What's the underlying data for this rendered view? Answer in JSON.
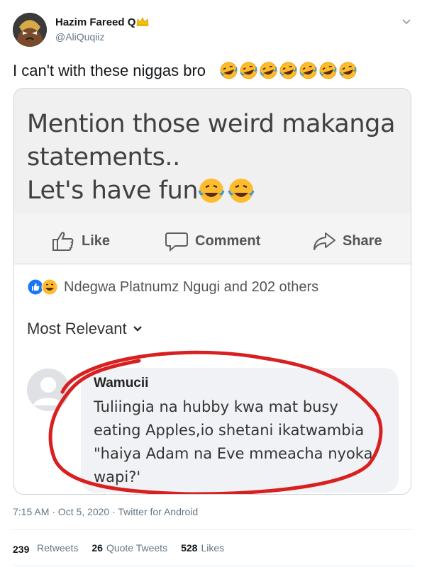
{
  "tweet": {
    "display_name": "Hazim Fareed Q",
    "handle": "@AliQuqiiz",
    "text": "I can't with these niggas bro",
    "emoji_count": 7,
    "timestamp": "7:15 AM · Oct 5, 2020 · Twitter for Android"
  },
  "media": {
    "post_lines": [
      "Mention those weird makanga",
      "statements..",
      "Let's have fun"
    ],
    "actions": {
      "like": "Like",
      "comment": "Comment",
      "share": "Share"
    },
    "reactions_text": "Ndegwa Platnumz Ngugi and 202 others",
    "sort_label": "Most Relevant",
    "comment": {
      "author": "Wamucii",
      "lines": [
        "Tuliingia na hubby kwa mat busy",
        "eating Apples,io shetani ikatwambia",
        "\"haiya Adam na Eve mmeacha nyoka",
        "wapi?'"
      ]
    }
  },
  "stats": {
    "retweets_count": "239",
    "retweets_label": "Retweets",
    "quote_count": "26",
    "quote_label": "Quote Tweets",
    "likes_count": "528",
    "likes_label": "Likes"
  },
  "colors": {
    "secondary_text": "#657786",
    "annotation_red": "#d92020",
    "facebook_blue": "#1877f2"
  },
  "icons": [
    "avatar",
    "crown-icon",
    "chevron-down-icon",
    "laughing-emoji-icon",
    "like-icon",
    "comment-icon",
    "share-icon",
    "facebook-like-reaction-icon",
    "haha-reaction-icon",
    "default-profile-icon"
  ]
}
